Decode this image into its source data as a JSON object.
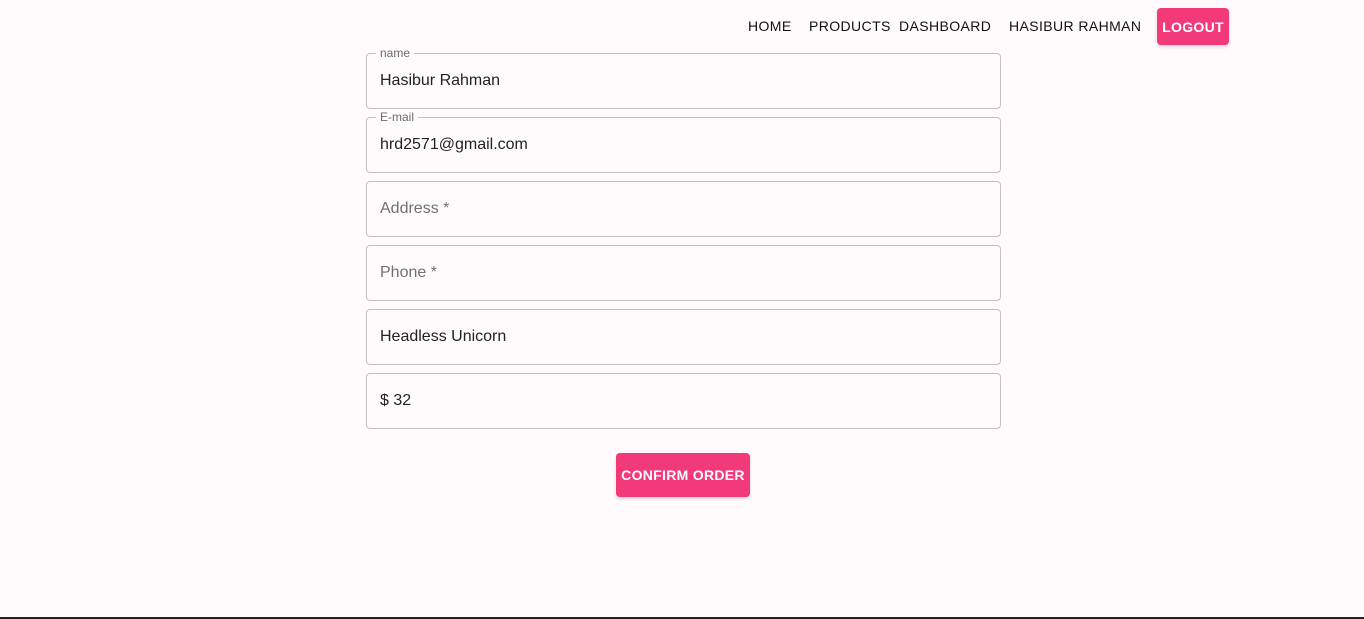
{
  "nav": {
    "home": "HOME",
    "products": "PRODUCTS",
    "dashboard": "DASHBOARD",
    "user": "HASIBUR RAHMAN",
    "logout": "LOGOUT"
  },
  "form": {
    "name": {
      "label": "name",
      "value": "Hasibur Rahman"
    },
    "email": {
      "label": "E-mail",
      "value": "hrd2571@gmail.com"
    },
    "address": {
      "placeholder": "Address *",
      "value": ""
    },
    "phone": {
      "placeholder": "Phone *",
      "value": ""
    },
    "product": {
      "value": "Headless Unicorn"
    },
    "price": {
      "value": "$ 32"
    },
    "confirm_label": "CONFIRM ORDER"
  },
  "colors": {
    "accent": "#f2397a",
    "background": "#fffbfc",
    "border": "#c4c0c2"
  }
}
